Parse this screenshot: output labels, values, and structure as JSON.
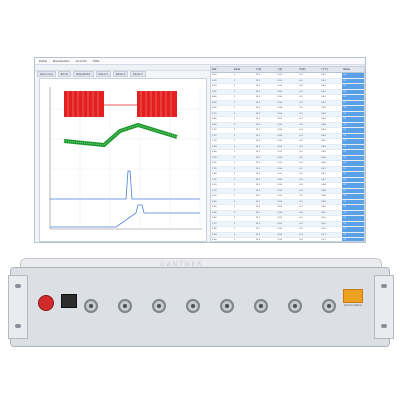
{
  "window": {
    "menu": [
      "Datei",
      "Bearbeiten",
      "Ansicht",
      "Hilfe"
    ],
    "tabs": [
      "Spannung",
      "Strom",
      "Temperatur",
      "Kanal 1",
      "Kanal 2",
      "Kanal 3"
    ]
  },
  "table": {
    "headers": [
      "Zeit",
      "Kanal",
      "U [V]",
      "I [A]",
      "P [W]",
      "T [°C]",
      "Status"
    ],
    "rows": [
      [
        "0.00",
        "1",
        "12.1",
        "0.52",
        "6.3",
        "24.1",
        "OK"
      ],
      [
        "0.10",
        "1",
        "12.1",
        "0.51",
        "6.2",
        "24.1",
        "OK"
      ],
      [
        "0.20",
        "1",
        "12.0",
        "0.53",
        "6.4",
        "24.2",
        "OK"
      ],
      [
        "0.30",
        "1",
        "12.1",
        "0.52",
        "6.3",
        "24.2",
        "OK"
      ],
      [
        "0.40",
        "1",
        "12.2",
        "0.50",
        "6.1",
        "24.2",
        "OK"
      ],
      [
        "0.50",
        "1",
        "12.1",
        "0.52",
        "6.3",
        "24.3",
        "OK"
      ],
      [
        "0.60",
        "1",
        "12.0",
        "0.54",
        "6.5",
        "24.3",
        "OK"
      ],
      [
        "0.70",
        "1",
        "12.1",
        "0.52",
        "6.3",
        "24.3",
        "OK"
      ],
      [
        "0.80",
        "1",
        "12.1",
        "0.51",
        "6.2",
        "24.4",
        "OK"
      ],
      [
        "0.90",
        "1",
        "12.2",
        "0.52",
        "6.3",
        "24.4",
        "OK"
      ],
      [
        "1.00",
        "1",
        "12.1",
        "0.53",
        "6.4",
        "24.4",
        "OK"
      ],
      [
        "1.10",
        "1",
        "12.1",
        "0.52",
        "6.3",
        "24.5",
        "OK"
      ],
      [
        "1.20",
        "1",
        "12.0",
        "0.52",
        "6.2",
        "24.5",
        "OK"
      ],
      [
        "1.30",
        "1",
        "12.1",
        "0.51",
        "6.2",
        "24.5",
        "OK"
      ],
      [
        "1.40",
        "1",
        "12.1",
        "0.52",
        "6.3",
        "24.6",
        "OK"
      ],
      [
        "1.50",
        "1",
        "12.2",
        "0.53",
        "6.5",
        "24.6",
        "OK"
      ],
      [
        "1.60",
        "1",
        "12.1",
        "0.52",
        "6.3",
        "24.6",
        "OK"
      ],
      [
        "1.70",
        "1",
        "12.1",
        "0.50",
        "6.1",
        "24.7",
        "OK"
      ],
      [
        "1.80",
        "1",
        "12.0",
        "0.52",
        "6.2",
        "24.7",
        "OK"
      ],
      [
        "1.90",
        "1",
        "12.1",
        "0.52",
        "6.3",
        "24.7",
        "OK"
      ],
      [
        "2.00",
        "1",
        "12.1",
        "0.53",
        "6.4",
        "24.8",
        "OK"
      ],
      [
        "2.10",
        "1",
        "12.2",
        "0.52",
        "6.3",
        "24.8",
        "OK"
      ],
      [
        "2.20",
        "1",
        "12.1",
        "0.51",
        "6.2",
        "24.8",
        "OK"
      ],
      [
        "2.30",
        "1",
        "12.1",
        "0.52",
        "6.3",
        "24.9",
        "OK"
      ],
      [
        "2.40",
        "1",
        "12.0",
        "0.52",
        "6.2",
        "24.9",
        "OK"
      ],
      [
        "2.50",
        "1",
        "12.1",
        "0.53",
        "6.4",
        "24.9",
        "OK"
      ],
      [
        "2.60",
        "1",
        "12.1",
        "0.52",
        "6.3",
        "25.0",
        "OK"
      ],
      [
        "2.70",
        "1",
        "12.2",
        "0.51",
        "6.2",
        "25.0",
        "OK"
      ],
      [
        "2.80",
        "1",
        "12.1",
        "0.52",
        "6.3",
        "25.0",
        "OK"
      ],
      [
        "2.90",
        "1",
        "12.1",
        "0.52",
        "6.3",
        "25.1",
        "OK"
      ],
      [
        "3.00",
        "1",
        "12.0",
        "0.53",
        "6.4",
        "25.1",
        "OK"
      ],
      [
        "3.10",
        "1",
        "12.1",
        "0.52",
        "6.3",
        "25.1",
        "OK"
      ],
      [
        "3.20",
        "1",
        "12.1",
        "0.51",
        "6.2",
        "25.2",
        "OK"
      ],
      [
        "3.30",
        "1",
        "12.2",
        "0.52",
        "6.3",
        "25.2",
        "OK"
      ],
      [
        "3.40",
        "1",
        "12.1",
        "0.52",
        "6.3",
        "25.2",
        "OK"
      ],
      [
        "3.50",
        "1",
        "12.1",
        "0.53",
        "6.4",
        "25.3",
        "OK"
      ]
    ]
  },
  "device": {
    "brand": "GANTNER",
    "connector_count": 8,
    "logo_caption": "Q.brixx station"
  },
  "colors": {
    "accent": "#5aa0e6",
    "signal_red": "#e32020",
    "signal_green": "#1f9a2e",
    "signal_blue": "#4a7fd8",
    "power": "#d22a2a",
    "badge": "#f0a020"
  }
}
